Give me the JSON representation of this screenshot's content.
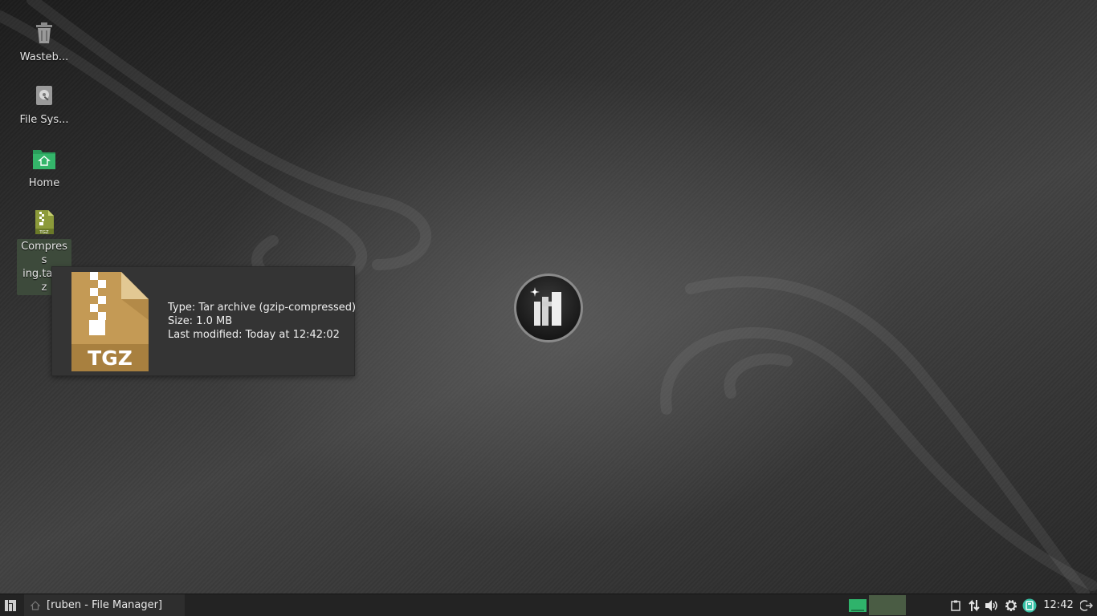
{
  "desktop": {
    "icons": [
      {
        "label": "Wasteb...",
        "icon": "trash-icon"
      },
      {
        "label": "File Sys...",
        "icon": "drive-icon"
      },
      {
        "label": "Home",
        "icon": "home-folder-icon"
      },
      {
        "label": "Compress\ning.tar.gz",
        "icon": "tgz-archive-icon"
      }
    ]
  },
  "tooltip": {
    "icon_text": "TGZ",
    "type": "Type: Tar archive (gzip-compressed)",
    "size": "Size: 1.0 MB",
    "modified": "Last modified: Today at 12:42:02"
  },
  "taskbar": {
    "menu_icon": "manjaro-menu-icon",
    "task_label": "[ruben - File Manager]",
    "clock": "12:42",
    "tray_icons": [
      "clipboard-icon",
      "network-icon",
      "volume-icon",
      "settings-icon",
      "update-icon",
      "logout-icon"
    ]
  },
  "colors": {
    "accent_green": "#2fb36b",
    "archive_tan": "#c49a55",
    "workspace_active": "#4a5c44"
  }
}
